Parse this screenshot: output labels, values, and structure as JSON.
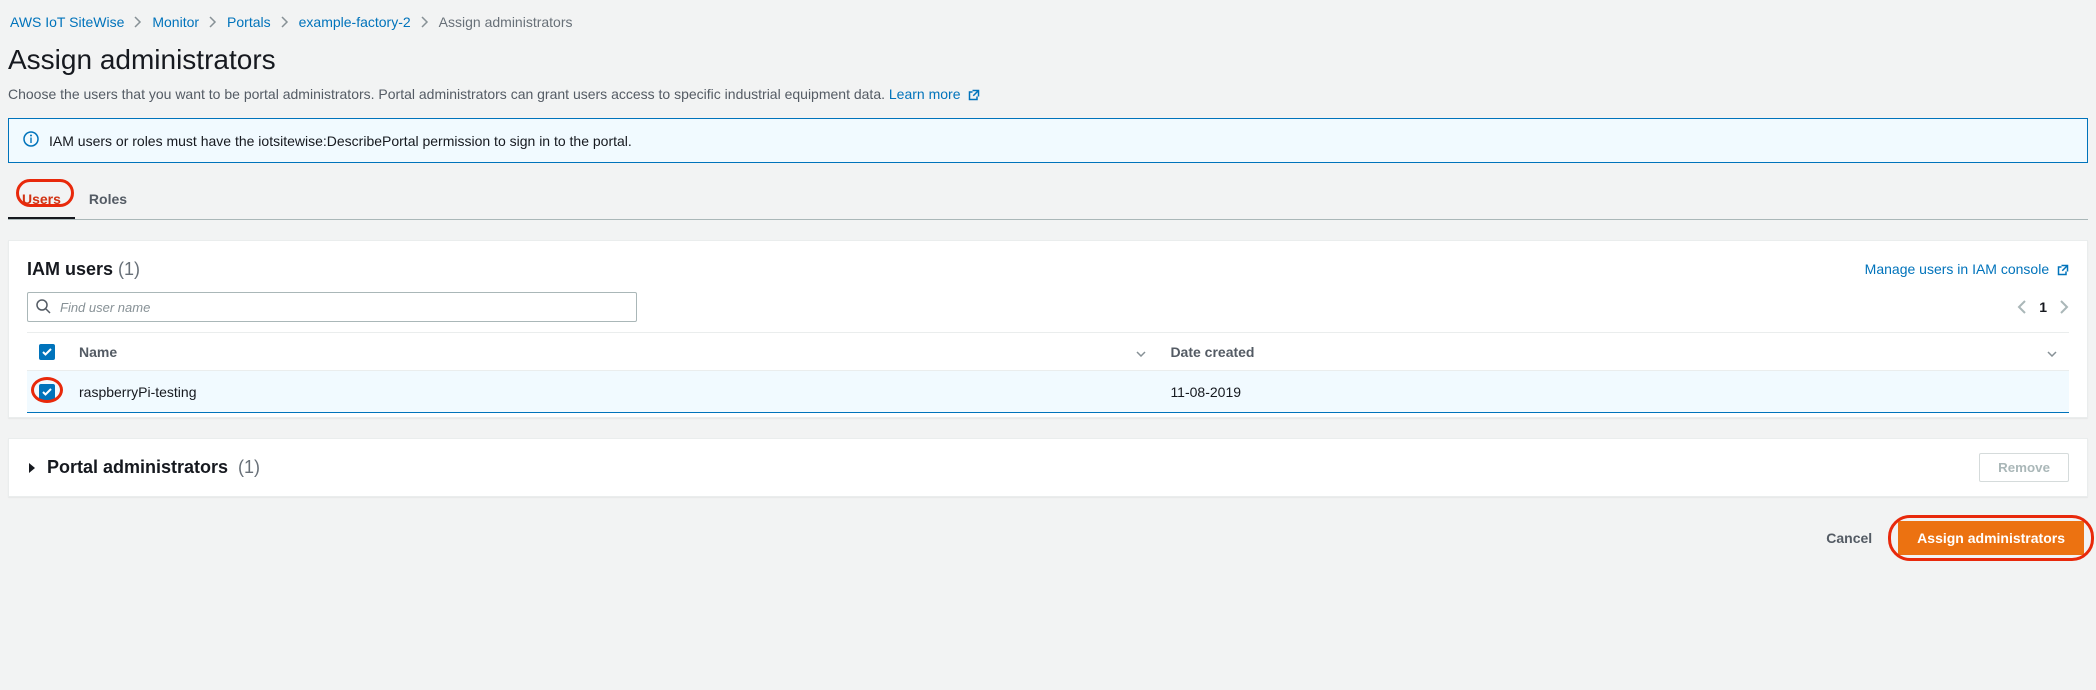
{
  "breadcrumbs": {
    "items": [
      "AWS IoT SiteWise",
      "Monitor",
      "Portals",
      "example-factory-2"
    ],
    "current": "Assign administrators"
  },
  "title": "Assign administrators",
  "description_prefix": "Choose the users that you want to be portal administrators. Portal administrators can grant users access to specific industrial equipment data. ",
  "learn_more": "Learn more",
  "info_message": "IAM users or roles must have the iotsitewise:DescribePortal permission to sign in to the portal.",
  "tabs": {
    "users": "Users",
    "roles": "Roles",
    "active": "users"
  },
  "iam_users": {
    "title": "IAM users",
    "count_display": "(1)",
    "manage_link": "Manage users in IAM console",
    "search_placeholder": "Find user name",
    "page_number": "1",
    "columns": {
      "name": "Name",
      "date_created": "Date created"
    },
    "rows": [
      {
        "name": "raspberryPi-testing",
        "date_created": "11-08-2019",
        "selected": true
      }
    ]
  },
  "portal_admins": {
    "title": "Portal administrators",
    "count_display": "(1)",
    "remove_label": "Remove"
  },
  "actions": {
    "cancel": "Cancel",
    "assign": "Assign administrators"
  }
}
